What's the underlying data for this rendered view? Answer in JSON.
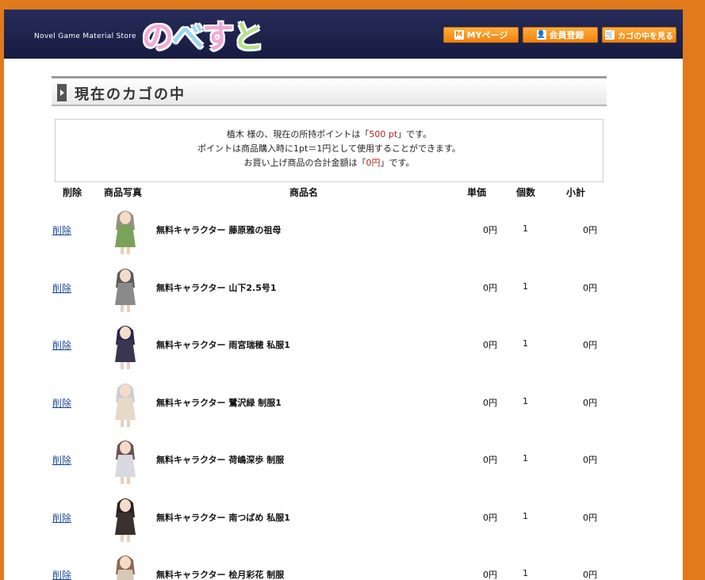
{
  "header": {
    "tagline": "Novel Game Material Store",
    "logo": [
      "の",
      "べ",
      "す",
      "と"
    ],
    "nav": [
      {
        "icon": "M",
        "label": "MYページ"
      },
      {
        "icon": "👤",
        "label": "会員登録"
      },
      {
        "icon": "🛒",
        "label": "カゴの中を見る"
      }
    ]
  },
  "page_title": "現在のカゴの中",
  "info": {
    "line1_pre": "植木 様の、現在の所持ポイントは「",
    "line1_points": "500 pt",
    "line1_post": "」です。",
    "line2": "ポイントは商品購入時に1pt＝1円として使用することができます。",
    "line3_pre": "お買い上げ商品の合計金額は「",
    "line3_total": "0円",
    "line3_post": "」です。"
  },
  "table": {
    "headers": {
      "delete": "削除",
      "photo": "商品写真",
      "name": "商品名",
      "price": "単価",
      "qty": "個数",
      "subtotal": "小計"
    },
    "delete_label": "削除",
    "rows": [
      {
        "name": "無料キャラクター 藤原雅の祖母",
        "price": "0円",
        "qty": "1",
        "subtotal": "0円",
        "hair": "#9a8f86",
        "outfit": "#7aa25a"
      },
      {
        "name": "無料キャラクター 山下2.5号1",
        "price": "0円",
        "qty": "1",
        "subtotal": "0円",
        "hair": "#5a5a5a",
        "outfit": "#8a8a8a"
      },
      {
        "name": "無料キャラクター 雨宮瑞穂 私服1",
        "price": "0円",
        "qty": "1",
        "subtotal": "0円",
        "hair": "#2b2550",
        "outfit": "#3a3550"
      },
      {
        "name": "無料キャラクター 鷺沢緑 制服1",
        "price": "0円",
        "qty": "1",
        "subtotal": "0円",
        "hair": "#c9ccd8",
        "outfit": "#e8d8c8"
      },
      {
        "name": "無料キャラクター 荷嶋深歩 制服",
        "price": "0円",
        "qty": "1",
        "subtotal": "0円",
        "hair": "#6a4f55",
        "outfit": "#d8d8e0"
      },
      {
        "name": "無料キャラクター 南つばめ 私服1",
        "price": "0円",
        "qty": "1",
        "subtotal": "0円",
        "hair": "#2a2220",
        "outfit": "#3a3030"
      },
      {
        "name": "無料キャラクター 桧月彩花 制服",
        "price": "0円",
        "qty": "1",
        "subtotal": "0円",
        "hair": "#8a6a55",
        "outfit": "#d8c8b8"
      }
    ]
  }
}
